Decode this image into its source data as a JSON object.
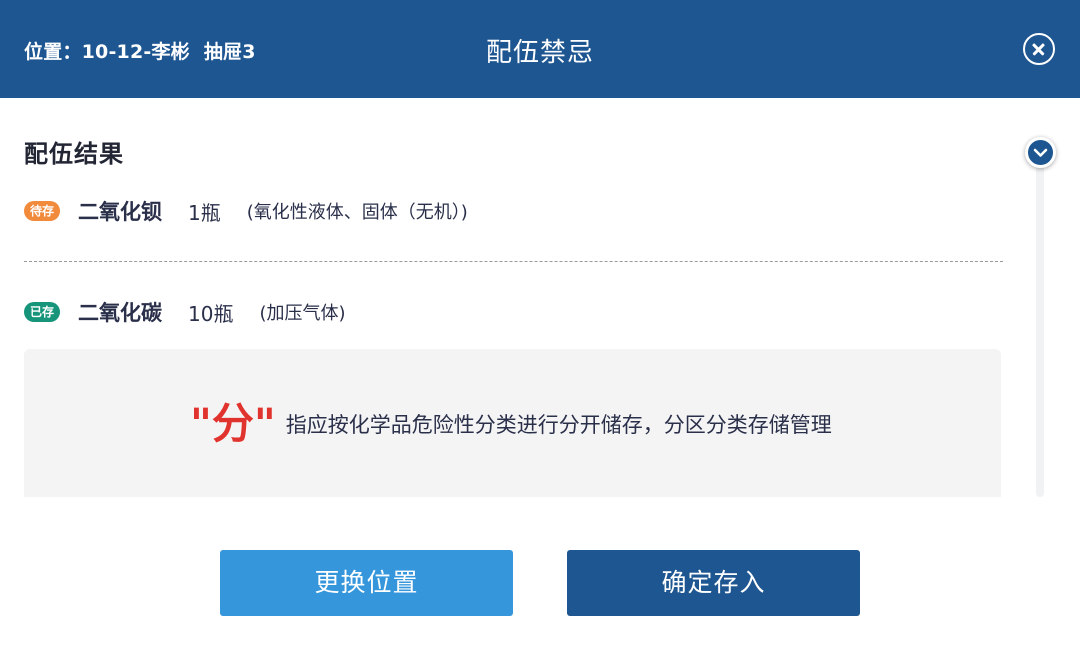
{
  "header": {
    "location": "位置：10-12-李彬",
    "drawer": "抽屉3",
    "title": "配伍禁忌"
  },
  "result": {
    "section_title": "配伍结果",
    "items": [
      {
        "badge": "待存",
        "name": "二氧化钡",
        "quantity": "1瓶",
        "category": "(氧化性液体、固体（无机）)"
      },
      {
        "badge": "已存",
        "name": "二氧化碳",
        "quantity": "10瓶",
        "category": "(加压气体)"
      }
    ]
  },
  "hint": {
    "keyword": "\"分\"",
    "text": "指应按化学品危险性分类进行分开储存，分区分类存储管理"
  },
  "buttons": {
    "change_location": "更换位置",
    "confirm_store": "确定存入"
  },
  "colors": {
    "header": "#1e5691",
    "pending_badge": "#f28a3c",
    "stored_badge": "#17957a",
    "keyword": "#e1332d",
    "secondary_button": "#3596dc",
    "primary_button": "#1e5691"
  },
  "icons": {
    "close": "close-circle-icon",
    "scroll": "chevron-down-icon"
  }
}
